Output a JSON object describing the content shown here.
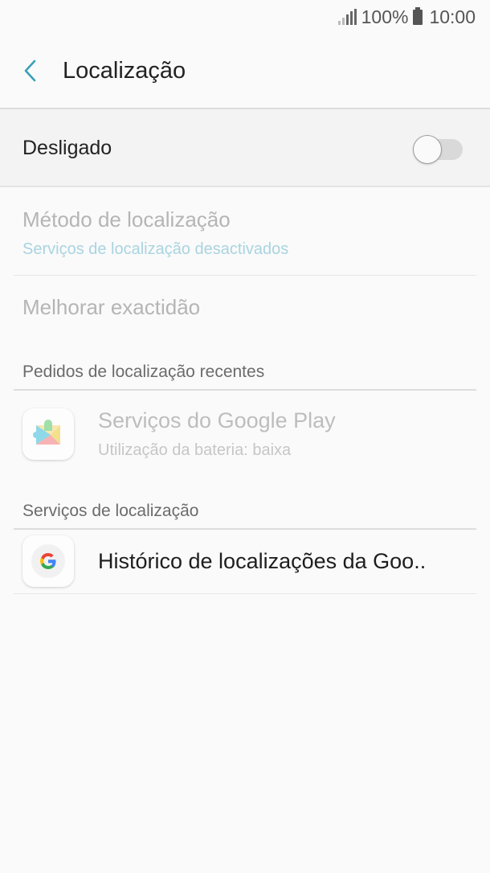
{
  "status_bar": {
    "battery_percent": "100%",
    "time": "10:00",
    "icons": [
      "signal-icon",
      "battery-icon"
    ]
  },
  "header": {
    "title": "Localização",
    "back_icon": "chevron-left-icon"
  },
  "master_toggle": {
    "label": "Desligado",
    "state": false
  },
  "settings": {
    "method": {
      "title": "Método de localização",
      "subtitle": "Serviços de localização desactivados"
    },
    "accuracy": {
      "title": "Melhorar exactidão"
    }
  },
  "recent_requests": {
    "header": "Pedidos de localização recentes",
    "items": [
      {
        "title": "Serviços do Google Play",
        "subtitle": "Utilização da bateria: baixa",
        "icon": "google-play-services-icon"
      }
    ]
  },
  "location_services": {
    "header": "Serviços de localização",
    "items": [
      {
        "title": "Histórico de localizações da Goo..",
        "icon": "google-g-icon"
      }
    ]
  },
  "colors": {
    "accent": "#3aa0b8",
    "disabled_text": "#b5b5b5",
    "disabled_subtitle": "#a9d4e0"
  }
}
